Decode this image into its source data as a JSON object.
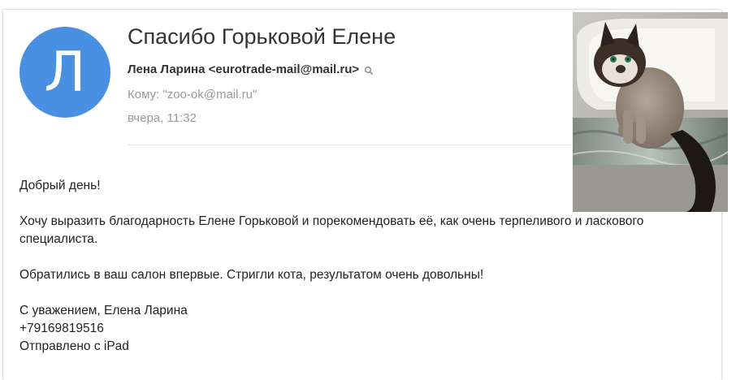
{
  "email": {
    "avatar_letter": "Л",
    "subject": "Спасибо Горьковой Елене",
    "from": "Лена Ларина <eurotrade-mail@mail.ru>",
    "to": "Кому: \"zoo-ok@mail.ru\"",
    "date": "вчера, 11:32",
    "body": {
      "greeting": "Добрый день!",
      "paragraph1": "Хочу выразить благодарность Елене Горьковой и порекомендовать её, как очень терпеливого и ласкового специалиста.",
      "paragraph2": "Обратились в ваш салон впервые. Стригли кота, результатом очень довольны!",
      "signoff": "С уважением, Елена Ларина",
      "phone": "+79169819516",
      "sent_from": "Отправлено с iPad"
    }
  },
  "colors": {
    "avatar": "#4a90e2",
    "meta_text": "#9a9a9a"
  },
  "icons": {
    "sender_search": "search-icon"
  }
}
